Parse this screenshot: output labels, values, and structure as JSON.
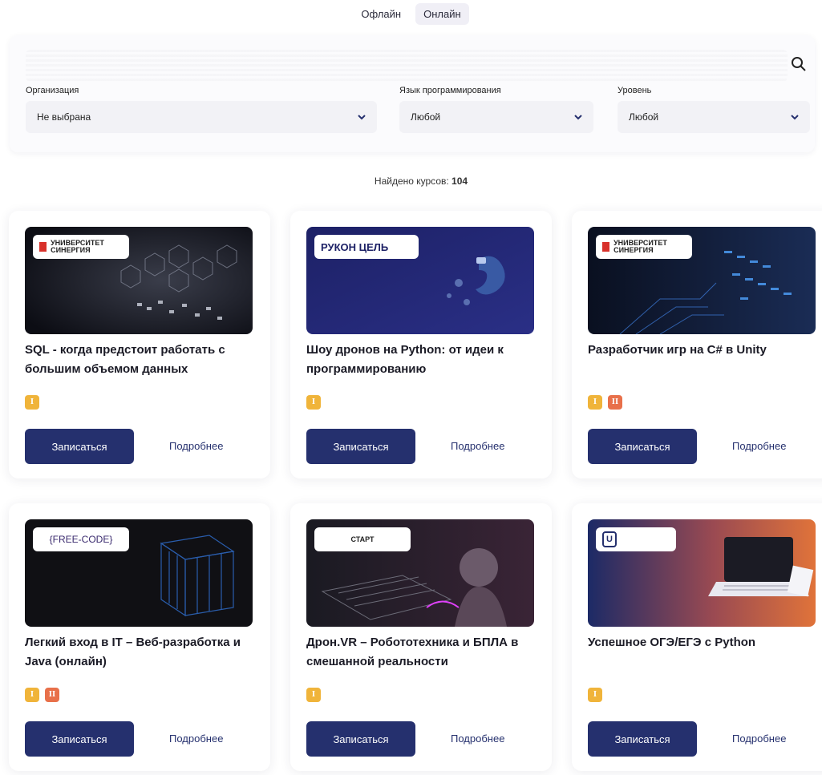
{
  "mode_tabs": [
    "Офлайн",
    "Онлайн"
  ],
  "filters": {
    "organization": {
      "label": "Организация",
      "value": "Не выбрана"
    },
    "language": {
      "label": "Язык программирования",
      "value": "Любой"
    },
    "level": {
      "label": "Уровень",
      "value": "Любой"
    }
  },
  "found": {
    "label": "Найдено курсов:",
    "count": "104"
  },
  "cards": [
    {
      "title": "SQL - когда предстоит работать с большим объемом данных",
      "logo": "УНИВЕРСИТЕТ СИНЕРГИЯ",
      "levels": [
        "I"
      ]
    },
    {
      "title": "Шоу дронов на Python: от идеи к программированию",
      "logo": "РУКОН ЦЕЛЬ",
      "levels": [
        "I"
      ]
    },
    {
      "title": "Разработчик игр на C# в Unity",
      "logo": "УНИВЕРСИТЕТ СИНЕРГИЯ",
      "levels": [
        "I",
        "II"
      ]
    },
    {
      "title": "Легкий вход в IT – Веб-разработка и Java (онлайн)",
      "logo": "{FREE-CODE}",
      "levels": [
        "I",
        "II"
      ]
    },
    {
      "title": "Дрон.VR – Робототехника и БПЛА в смешанной реальности",
      "logo": "СТАРТ",
      "levels": [
        "I"
      ]
    },
    {
      "title": "Успешное ОГЭ/ЕГЭ с Python",
      "logo": "U",
      "levels": [
        "I"
      ]
    }
  ],
  "buttons": {
    "enroll": "Записаться",
    "more": "Подробнее"
  },
  "colors": {
    "primary": "#25306e",
    "level_1": "#f0b43a",
    "level_2": "#e8704a"
  }
}
